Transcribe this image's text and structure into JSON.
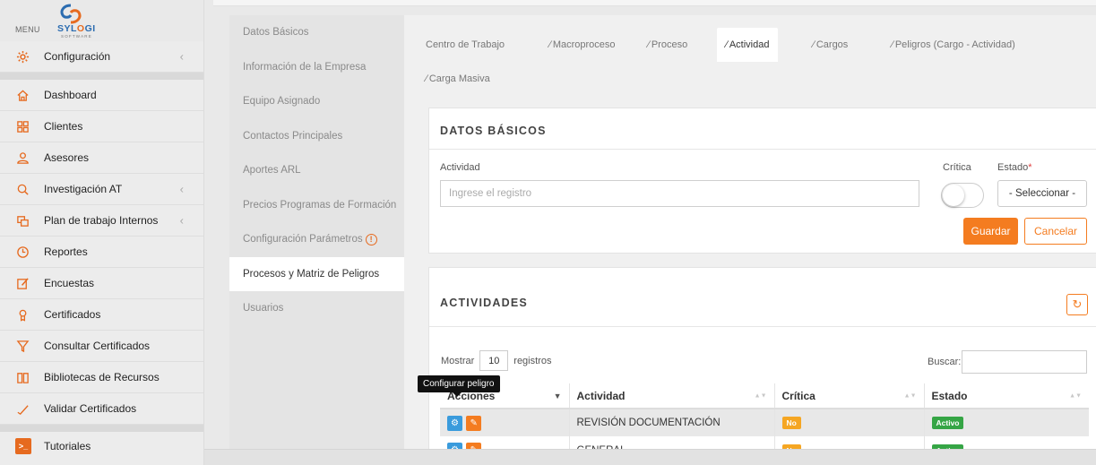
{
  "sidebar": {
    "menu_label": "MENU",
    "brand": {
      "name_prefix": "SYL",
      "name_accent": "O",
      "name_suffix": "GI",
      "tagline": "SOFTWARE"
    },
    "config_item": {
      "label": "Configuración",
      "icon": "gear-icon"
    },
    "items": [
      {
        "label": "Dashboard",
        "icon": "home-icon"
      },
      {
        "label": "Clientes",
        "icon": "grid-icon"
      },
      {
        "label": "Asesores",
        "icon": "user-icon"
      },
      {
        "label": "Investigación AT",
        "icon": "search-icon",
        "expandable": true
      },
      {
        "label": "Plan de trabajo Internos",
        "icon": "folders-icon",
        "expandable": true
      },
      {
        "label": "Reportes",
        "icon": "clock-icon"
      },
      {
        "label": "Encuestas",
        "icon": "edit-icon"
      },
      {
        "label": "Certificados",
        "icon": "award-icon"
      },
      {
        "label": "Consultar Certificados",
        "icon": "filter-icon"
      },
      {
        "label": "Bibliotecas de Recursos",
        "icon": "book-icon"
      },
      {
        "label": "Validar Certificados",
        "icon": "check-icon"
      }
    ],
    "tutorials": {
      "label": "Tutoriales",
      "icon": "terminal-icon"
    }
  },
  "subnav": {
    "items": [
      {
        "label": "Datos Básicos"
      },
      {
        "label": "Información de la Empresa"
      },
      {
        "label": "Equipo Asignado"
      },
      {
        "label": "Contactos Principales"
      },
      {
        "label": "Aportes ARL"
      },
      {
        "label": "Precios Programas de Formación"
      },
      {
        "label": "Configuración Parámetros",
        "warning_glyph": "!"
      },
      {
        "label": "Procesos y Matriz de Peligros",
        "active": true
      },
      {
        "label": "Usuarios"
      }
    ]
  },
  "tabs": [
    {
      "label": "Centro de Trabajo"
    },
    {
      "label": "Macroproceso"
    },
    {
      "label": "Proceso"
    },
    {
      "label": "Actividad",
      "active": true
    },
    {
      "label": "Cargos"
    },
    {
      "label": "Peligros (Cargo - Actividad)"
    },
    {
      "label": "Carga Masiva"
    }
  ],
  "form": {
    "title": "DATOS BÁSICOS",
    "actividad_label": "Actividad",
    "actividad_placeholder": "Ingrese el registro",
    "critica_label": "Crítica",
    "critica_on": false,
    "estado_label": "Estado",
    "estado_required": "*",
    "estado_selected": "- Seleccionar -",
    "save_label": "Guardar",
    "cancel_label": "Cancelar"
  },
  "activities": {
    "title": "ACTIVIDADES",
    "show_label": "Mostrar",
    "page_size": "10",
    "records_label": "registros",
    "search_label": "Buscar:",
    "columns": {
      "acciones": "Acciones",
      "actividad": "Actividad",
      "critica": "Crítica",
      "estado": "Estado"
    },
    "rows": [
      {
        "actividad": "REVISIÓN DOCUMENTACIÓN",
        "critica": "No",
        "estado": "Activo"
      },
      {
        "actividad": "GENERAL",
        "critica": "No",
        "estado": "Activo"
      }
    ],
    "tooltip": "Configurar peligro"
  },
  "colors": {
    "accent": "#f47c20",
    "info": "#3a9bdc",
    "success": "#35a545",
    "warning": "#f5a623"
  }
}
